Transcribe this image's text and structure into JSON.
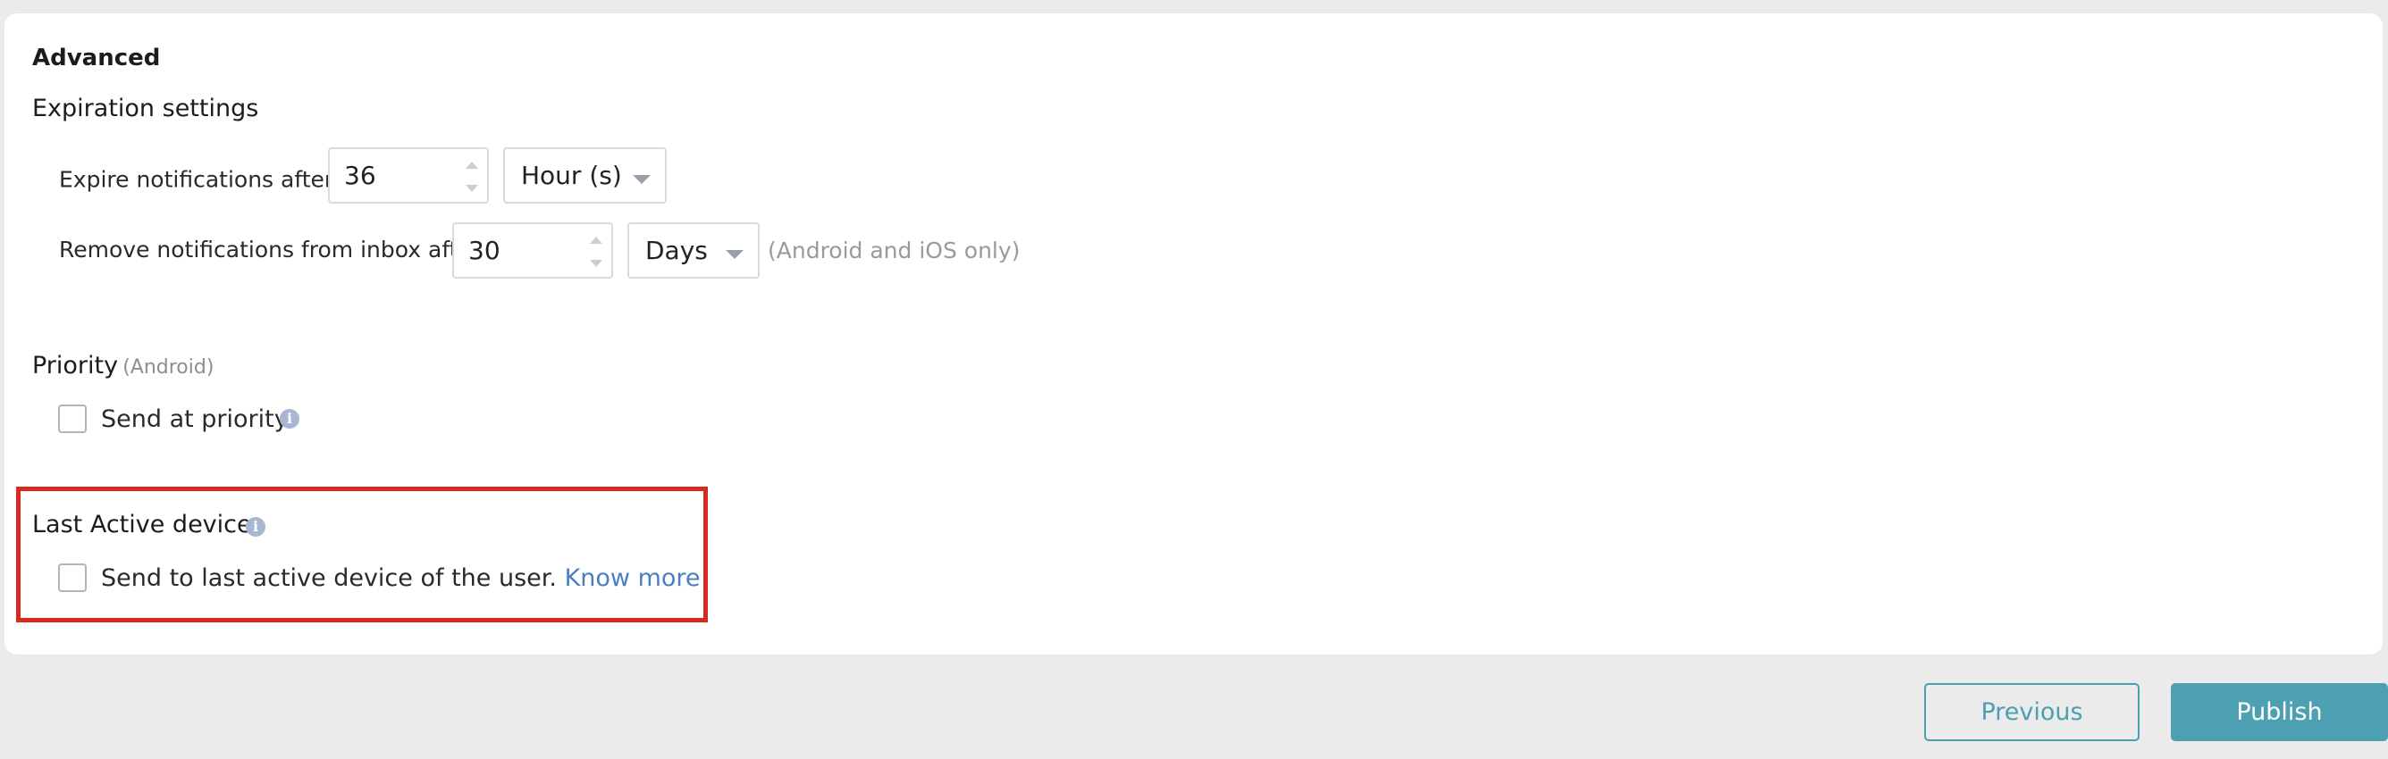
{
  "advanced": {
    "title": "Advanced",
    "expiration": {
      "title": "Expiration settings",
      "expire_label": "Expire notifications after",
      "required_mark": "*",
      "expire_value": "36",
      "expire_unit": "Hour (s)",
      "remove_label": "Remove notifications from inbox after",
      "remove_value": "30",
      "remove_unit": "Days",
      "remove_note": "(Android and iOS only)"
    },
    "priority": {
      "title": "Priority",
      "platform": "(Android)",
      "checkbox_label": "Send at priority",
      "checked": false
    },
    "last_active": {
      "title": "Last Active device",
      "checkbox_label": "Send to last active device of the user.",
      "link_text": "Know more",
      "checked": false
    }
  },
  "footer": {
    "previous_label": "Previous",
    "publish_label": "Publish"
  },
  "icons": {
    "info": "info-icon",
    "spinner": "spinner-arrows-icon",
    "dropdown": "chevron-down-icon"
  },
  "colors": {
    "accent": "#4da0b2",
    "link": "#4a7ec3",
    "highlight": "#d8291f",
    "info_icon": "#a8b6d2"
  }
}
